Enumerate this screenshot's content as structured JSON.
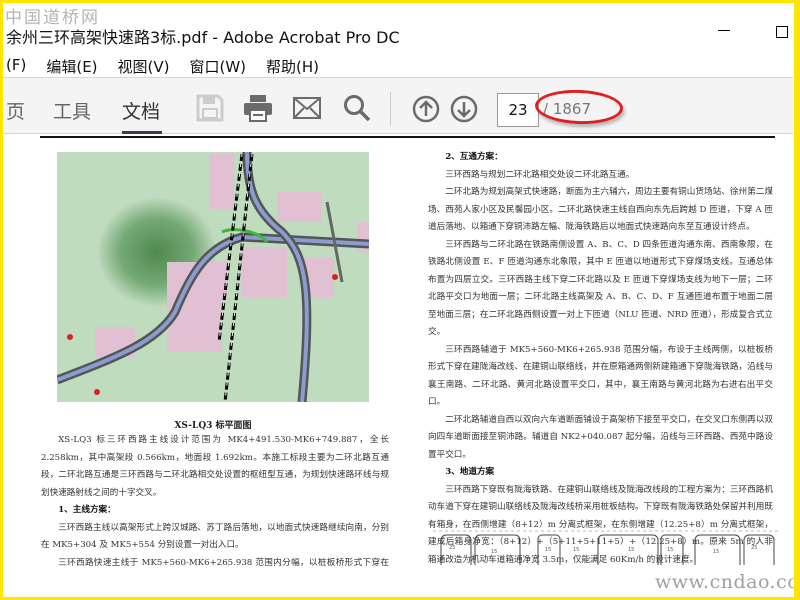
{
  "watermark_top": "中国道桥网",
  "window": {
    "title": "余州三环高架快速路3标.pdf - Adobe Acrobat Pro DC"
  },
  "menu": [
    "(F)",
    "编辑(E)",
    "视图(V)",
    "窗口(W)",
    "帮助(H)"
  ],
  "tabs": [
    {
      "label": "页"
    },
    {
      "label": "工具"
    },
    {
      "label": "文档",
      "active": true
    }
  ],
  "toolbar": {
    "icons": [
      "save-icon",
      "print-icon",
      "email-icon",
      "search-icon",
      "page-up-icon",
      "page-down-icon"
    ],
    "current_page": "23",
    "total_pages": "/ 1867"
  },
  "left_page": {
    "caption": "XS-LQ3 标平面图",
    "paragraphs": [
      {
        "text": "XS-LQ3 标三环西路主线设计范围为 MK4+491.530-MK6+749.887，全长 2.258km，其中高架段 0.566km，地面段 1.692km。本施工标段主要为二环北路互通段，二环北路互通是三环西路与二环北路相交处设置的枢纽型互通，为规划快速路环线与规划快速路射线之间的十字交叉。"
      },
      {
        "text": "1、主线方案：",
        "heading": true
      },
      {
        "text": "三环西路主线以高架形式上跨汉城路、苏丁路后落地，以地面式快速路继续向南，分别在 MK5+304 及 MK5+554 分别设置一对出入口。"
      },
      {
        "text": "三环西路快速主线于 MK5+560-MK6+265.938 范围内分幅，以桩板桥形式下穿在建陇海改线"
      }
    ]
  },
  "right_page": {
    "paragraphs": [
      {
        "text": "2、互通方案：",
        "heading": true
      },
      {
        "text": "三环西路与规划二环北路相交处设二环北路互通。"
      },
      {
        "text": "二环北路为规划高架式快速路，断面为主六辅六，周边主要有铜山货场站、徐州第二煤场、西苑人家小区及民馨园小区。二环北路快速主线自西向东先后跨越 D 匝道，下穿 A 匝道后落地、以箱通下穿铜沛路左幅、陇海铁路后以地面式快速路向东至互通设计终点。"
      },
      {
        "text": "三环西路与二环北路在铁路南侧设置 A、B、C、D 四条匝道沟通东南、西南象限，在铁路北侧设置 E、F 匝道沟通东北象限，其中 E 匝道以地道形式下穿煤场支线。互通总体布置为四层立交。三环西路主线下穿二环北路以及 E 匝道下穿煤场支线为地下一层；二环北路平交口为地面一层；二环北路主线高架及 A、B、C、D、F 互通匝道布置于地面二层至地面三层；在二环北路西侧设置一对上下匝道（NLU 匝道、NRD 匝道），形成复合式立交。"
      },
      {
        "text": "三环西路辅道于 MK5+560-MK6+265.938 范围分幅，布设于主线两侧，以桩板桥形式下穿在建陇海改线、在建铜山联络线，并在原箱通两侧新建箱通下穿陇海铁路，沿线与襄王南路、二环北路、黄河北路设置平交口，其中，襄王南路与黄河北路为右进右出平交口。"
      },
      {
        "text": "二环北路辅道自西以双向六车道断面铺设于高架桥下接至平交口，在交叉口东侧再以双向四车道断面接至铜沛路。辅道自 NK2+040.087 起分幅，沿线与三环西路、西苑中路设置平交口。"
      },
      {
        "text": "3、地道方案",
        "heading": true
      },
      {
        "text": "三环西路下穿既有陇海铁路、在建铜山联络线及陇海改线段的工程方案为：三环西路机动车道下穿在建铜山联络线及陇海改线桥采用桩板结构。下穿既有陇海铁路处保留并利用既有箱身，在西侧增建（8+12）m 分离式框架，在东侧增建（12.25+8）m 分离式框架，建成后箱身净宽：（8+12）+（5+11+5+11+5）+（12.25+8）m。原来 5m 的人非箱通改造为机动车道箱通净宽 3.5m，仅能满足 60Km/h 的设计速度。",
        "bold_tail": true
      }
    ],
    "figure_labels": [
      "25",
      "15",
      "15",
      "15",
      "15",
      "15",
      "15",
      "25"
    ]
  },
  "watermark_bottom": "www.cndao.com",
  "colors": {
    "accent": "#4b3354",
    "highlight": "#e02020",
    "border": "#ffe600"
  }
}
